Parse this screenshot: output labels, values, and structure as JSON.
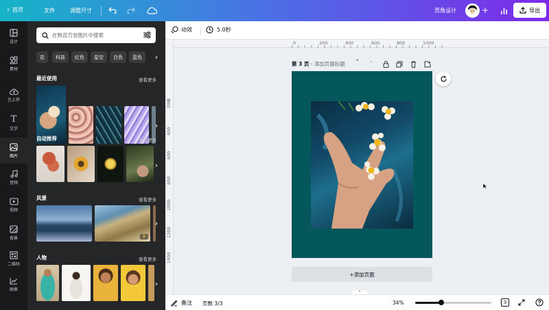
{
  "topbar": {
    "home": "首页",
    "file": "文件",
    "resize": "调整尺寸",
    "design_title": "页角设计",
    "export": "导出"
  },
  "rail": {
    "items": [
      {
        "label": "设计",
        "icon": "layout-icon"
      },
      {
        "label": "素材",
        "icon": "elements-icon"
      },
      {
        "label": "已上传",
        "icon": "upload-icon"
      },
      {
        "label": "文字",
        "icon": "text-icon"
      },
      {
        "label": "图片",
        "icon": "photo-icon"
      },
      {
        "label": "音频",
        "icon": "music-icon"
      },
      {
        "label": "视频",
        "icon": "video-icon"
      },
      {
        "label": "背景",
        "icon": "background-icon"
      },
      {
        "label": "二维码",
        "icon": "qrcode-icon"
      },
      {
        "label": "图表",
        "icon": "chart-icon"
      }
    ],
    "active_index": 4
  },
  "panel": {
    "search_placeholder": "在数百万张图片中搜索",
    "chips": [
      "花",
      "科技",
      "红色",
      "星空",
      "白色",
      "蓝色"
    ],
    "sections": [
      {
        "title": "最近使用",
        "more": ""
      },
      {
        "title": "自动推荐",
        "more": "查看更多"
      },
      {
        "title": "风景",
        "more": "查看更多"
      },
      {
        "title": "人物",
        "more": "查看更多"
      }
    ],
    "recent_more": "查看更多"
  },
  "toolbar2": {
    "animate": "动效",
    "duration": "5.0秒"
  },
  "ruler": {
    "top": [
      "0",
      "200",
      "400",
      "600",
      "800",
      "1000"
    ],
    "left": [
      "0",
      "200",
      "400",
      "600",
      "800",
      "1000",
      "1200",
      "1400"
    ]
  },
  "pagebar": {
    "page_label": "第 3 页",
    "separator": " - ",
    "title_placeholder": "添加页面标题"
  },
  "canvas": {
    "add_page": "+添加页面",
    "page_bg": "#04575a"
  },
  "bottombar": {
    "notes": "备注",
    "pages": "页数 3/3",
    "zoom": "34%",
    "zoom_fraction": 0.34,
    "page_count_badge": "3"
  },
  "colors": {
    "rail_bg": "#18191b",
    "panel_bg": "#252627",
    "gradient_start": "#16b4c8",
    "gradient_end": "#7d2ae8"
  }
}
